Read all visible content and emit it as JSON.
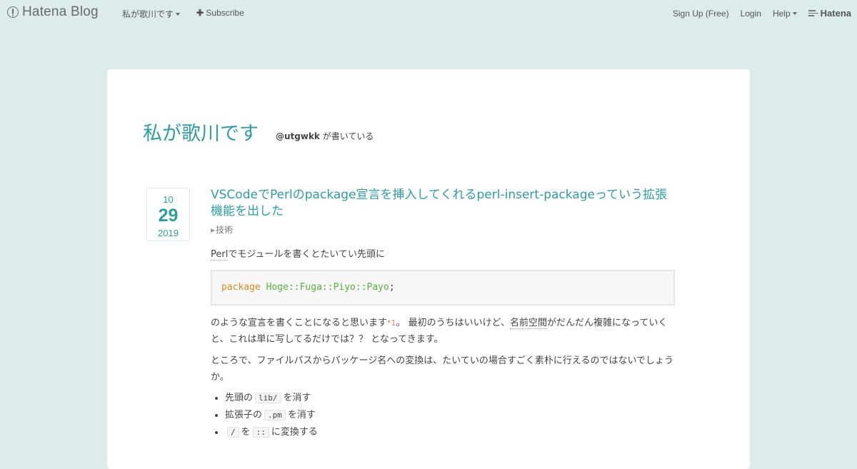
{
  "topbar": {
    "logo_text": "Hatena Blog",
    "blog_menu": "私が歌川です",
    "subscribe": "Subscribe",
    "signup": "Sign Up (Free)",
    "login": "Login",
    "help": "Help",
    "brand": "Hatena"
  },
  "blog": {
    "title": "私が歌川です",
    "author": "@utgwkk",
    "desc_suffix": " が書いている"
  },
  "entry": {
    "date": {
      "month": "10",
      "day": "29",
      "year": "2019"
    },
    "title": "VSCodeでPerlのpackage宣言を挿入してくれるperl-insert-packageっていう拡張機能を出した",
    "category": "技術",
    "p1_kw": "Perl",
    "p1_rest": "でモジュールを書くとたいてい先頭に",
    "code": {
      "keyword": "package",
      "parts": [
        "Hoge",
        "::",
        "Fuga",
        "::",
        "Piyo",
        "::",
        "Payo"
      ],
      "end": ";"
    },
    "p2_a": "のような宣言を書くことになると思います",
    "p2_fn": "*1",
    "p2_b": "。 最初のうちはいいけど、",
    "p2_kw": "名前空間",
    "p2_c": "がだんだん複雑になっていくと、これは単に写してるだけでは？？ となってきます。",
    "p3": "ところで、ファイルパスからパッケージ名への変換は、たいていの場合すごく素朴に行えるのではないでしょうか。",
    "list": [
      {
        "pre": "先頭の",
        "code": "lib/",
        "post": "を消す"
      },
      {
        "pre": "拡張子の",
        "code": ".pm",
        "post": "を消す"
      },
      {
        "code1": "/",
        "mid": "を",
        "code2": "::",
        "post": "に変換する"
      }
    ]
  },
  "colors": {
    "accent": "#2d9e9e",
    "background": "#dcebeb",
    "keyword": "#d88a1c",
    "namespace": "#56b13d"
  }
}
